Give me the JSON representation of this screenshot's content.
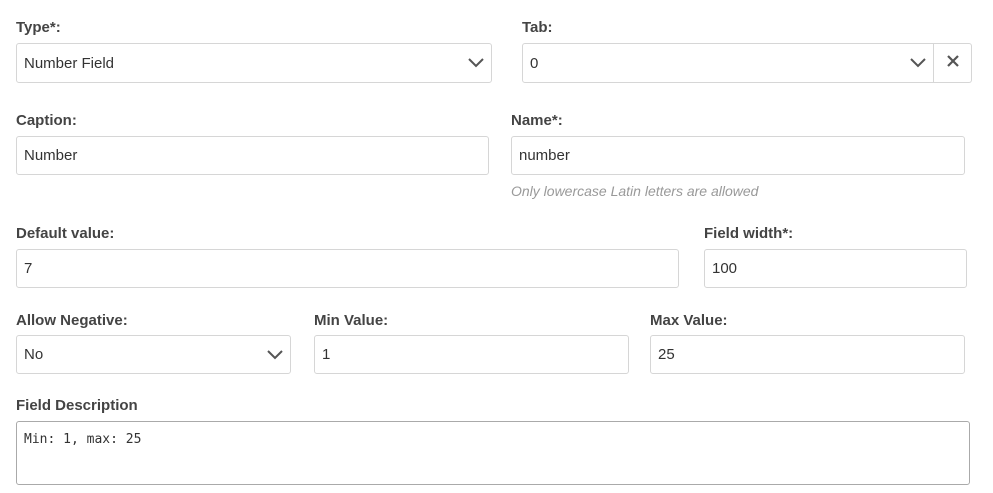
{
  "type": {
    "label": "Type*:",
    "value": "Number Field",
    "icon": "chevron-down-icon"
  },
  "tab": {
    "label": "Tab:",
    "value": "0",
    "icon": "chevron-down-icon",
    "clear_icon": "close-icon"
  },
  "caption": {
    "label": "Caption:",
    "value": "Number"
  },
  "name": {
    "label": "Name*:",
    "value": "number",
    "hint": "Only lowercase Latin letters are allowed"
  },
  "default_value": {
    "label": "Default value:",
    "value": "7"
  },
  "field_width": {
    "label": "Field width*:",
    "value": "100"
  },
  "allow_negative": {
    "label": "Allow Negative:",
    "value": "No",
    "icon": "chevron-down-icon"
  },
  "min_value": {
    "label": "Min Value:",
    "value": "1"
  },
  "max_value": {
    "label": "Max Value:",
    "value": "25"
  },
  "field_description": {
    "label": "Field Description",
    "value": "Min: 1, max: 25"
  },
  "colors": {
    "border": "#d6d6d6",
    "label": "#444444",
    "hint": "#999999",
    "icon": "#555555"
  }
}
